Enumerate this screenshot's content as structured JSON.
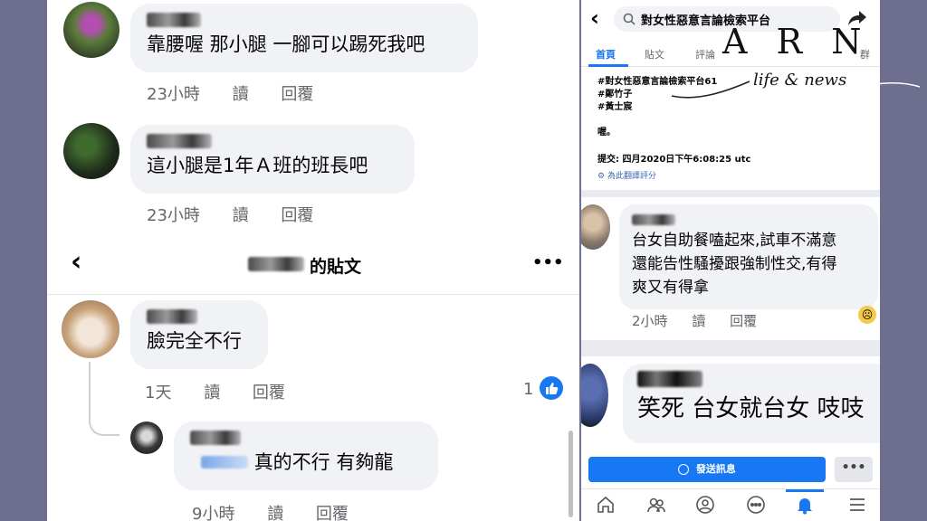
{
  "left": {
    "comments_top": [
      {
        "text": "靠腰喔 那小腿 一腳可以踢死我吧",
        "time": "23小時",
        "read": "讀",
        "reply": "回覆"
      },
      {
        "text": "這小腿是1年Ａ班的班長吧",
        "time": "23小時",
        "read": "讀",
        "reply": "回覆"
      }
    ],
    "header": {
      "title_suffix": "的貼文",
      "more": "•••"
    },
    "comments_bottom": [
      {
        "text": "臉完全不行",
        "time": "1天",
        "read": "讀",
        "reply": "回覆",
        "reaction_count": "1"
      },
      {
        "text": "真的不行 有夠龍",
        "time": "9小時",
        "read": "讀",
        "reply": "回覆"
      }
    ]
  },
  "right": {
    "search_title": "對女性惡意言論檢索平台",
    "tabs": [
      "首頁",
      "貼文",
      "評論",
      "群"
    ],
    "post": {
      "line1": "#對女性惡意言論檢索平台61",
      "line2": "#鄭竹子",
      "line3": "#黃士宸",
      "line4": "喔。",
      "submitted": "提交: 四月2020日下午6:08:25 utc",
      "rate": "為此翻譯評分"
    },
    "comment1": {
      "lines": [
        "台女自助餐嗑起來,試車不滿意",
        "還能告性騷擾跟強制性交,有得",
        "爽又有得拿"
      ],
      "time": "2小時",
      "read": "讀",
      "reply": "回覆"
    },
    "comment2": {
      "text": "笑死 台女就台女 吱吱"
    },
    "message_button": "發送訊息",
    "more_button": "•••",
    "watermark": {
      "letters": "A R N",
      "tagline": "life & news"
    }
  },
  "colors": {
    "fb_blue": "#1877f2",
    "bubble": "#f0f2f5",
    "background": "#6e6f8f"
  }
}
